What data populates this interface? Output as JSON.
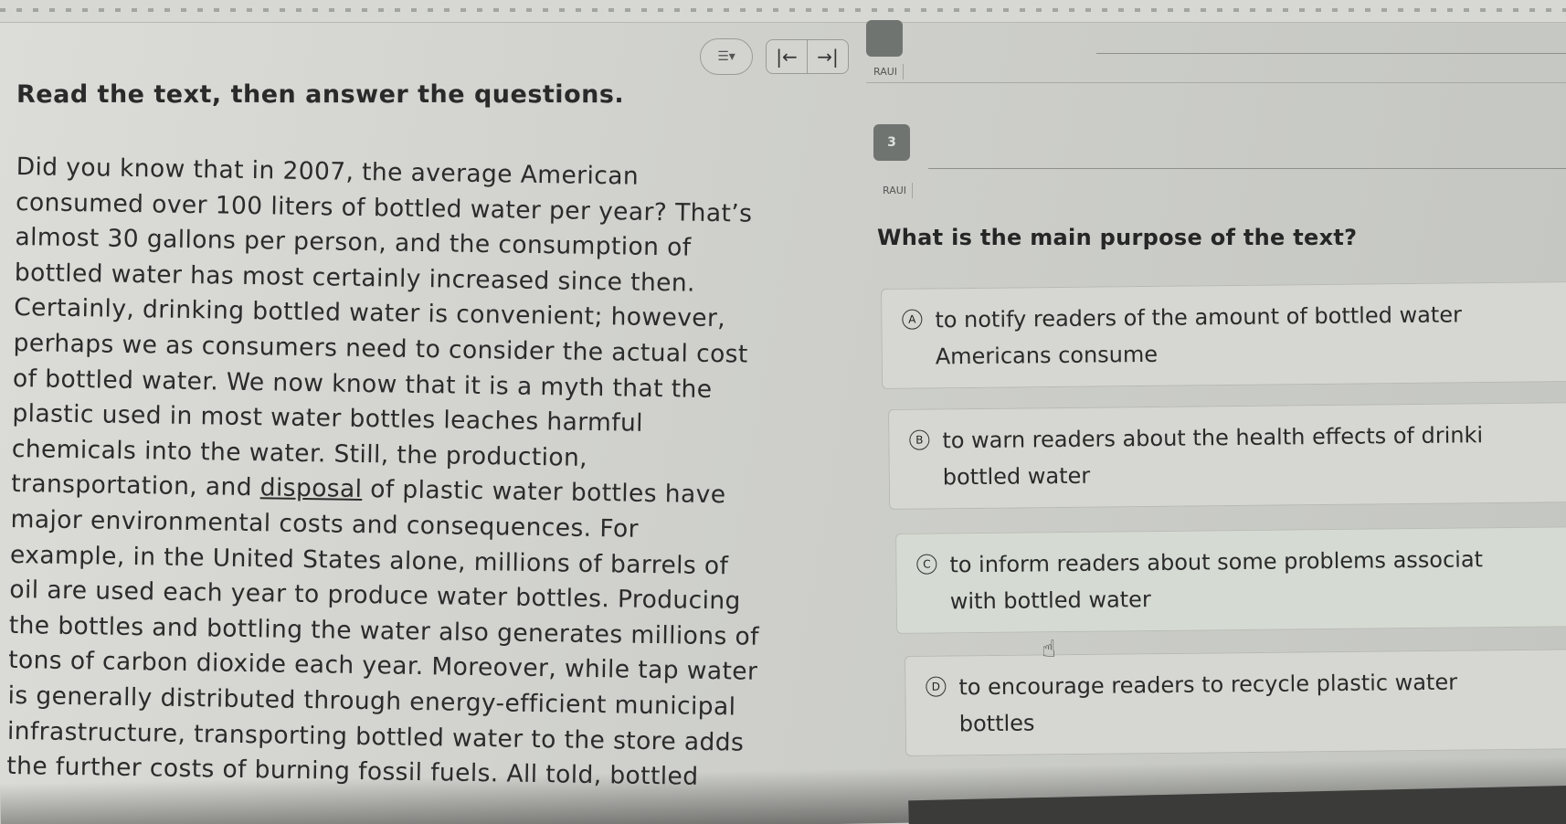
{
  "toolbar": {
    "menu_icon": "list-icon",
    "prev_icon": "skip-back-icon",
    "next_icon": "skip-forward-icon"
  },
  "header": {
    "tag_top": "RAUI",
    "tag_question": "RAUI",
    "question_number": "3"
  },
  "instruction": "Read the text, then answer the questions.",
  "passage": {
    "lines": [
      "Did you know that in 2007, the average American",
      "consumed over 100 liters of bottled water per year? That’s",
      "almost 30 gallons per person, and the consumption of",
      "bottled water has most certainly increased since then.",
      "Certainly, drinking bottled water is convenient; however,",
      "perhaps we as consumers need to consider the actual cost",
      "of bottled water. We now know that it is a myth that the",
      "plastic used in most water bottles leaches harmful",
      "chemicals into the water. Still, the production,",
      "major environmental costs and consequences. For",
      "example, in the United States alone, millions of barrels of",
      "oil are used each year to produce water bottles. Producing",
      "the bottles and bottling the water also generates millions of",
      "tons of carbon dioxide each year. Moreover, while tap water",
      "is generally distributed through energy-efficient municipal",
      "infrastructure, transporting bottled water to the store adds",
      "the further costs of burning fossil fuels. All told, bottled"
    ],
    "line11_before": "transportation, and ",
    "line11_underlined": "disposal",
    "line11_after": " of plastic water bottles have"
  },
  "question": {
    "prompt": "What is the main purpose of the text?",
    "options": [
      {
        "letter": "A",
        "line1": "to notify readers of the amount of bottled water",
        "line2": "Americans consume"
      },
      {
        "letter": "B",
        "line1": "to warn readers about the health effects of drinki",
        "line2": "bottled water"
      },
      {
        "letter": "C",
        "line1": "to inform readers about some problems associat",
        "line2": "with bottled water"
      },
      {
        "letter": "D",
        "line1": "to encourage readers to recycle plastic water",
        "line2": "bottles"
      }
    ]
  },
  "cursor_icon": "hand-pointer-icon"
}
